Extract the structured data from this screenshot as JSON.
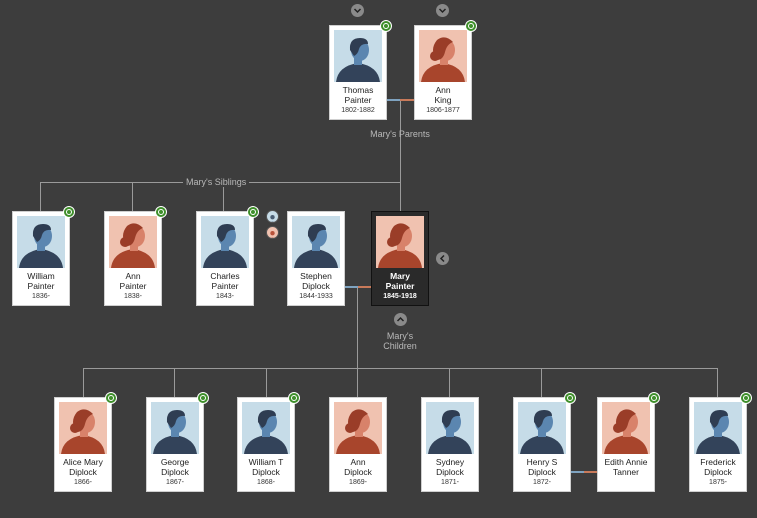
{
  "colors": {
    "background": "#3d3d3d",
    "male_bg": "#c6dce8",
    "female_bg": "#f0c2b0",
    "badge": "#3f8f2b"
  },
  "parents": {
    "label": "Mary's Parents",
    "father": {
      "name1": "Thomas",
      "name2": "Painter",
      "years": "1802-1882",
      "gender": "male",
      "icon": "hint-leaf-icon"
    },
    "mother": {
      "name1": "Ann",
      "name2": "King",
      "years": "1806-1877",
      "gender": "female",
      "icon": "hint-leaf-icon"
    }
  },
  "siblings": {
    "label": "Mary's Siblings",
    "people": [
      {
        "name1": "William",
        "name2": "Painter",
        "years": "1836-",
        "gender": "male"
      },
      {
        "name1": "Ann",
        "name2": "Painter",
        "years": "1838-",
        "gender": "female"
      },
      {
        "name1": "Charles",
        "name2": "Painter",
        "years": "1843-",
        "gender": "male"
      },
      {
        "name1": "Stephen",
        "name2": "Diplock",
        "years": "1844-1933",
        "gender": "male"
      }
    ]
  },
  "focus": {
    "name1": "Mary",
    "name2": "Painter",
    "years": "1845-1918",
    "gender": "female"
  },
  "children": {
    "label1": "Mary's",
    "label2": "Children",
    "people": [
      {
        "name1": "Alice Mary",
        "name2": "Diplock",
        "years": "1866-",
        "gender": "female"
      },
      {
        "name1": "George",
        "name2": "Diplock",
        "years": "1867-",
        "gender": "male"
      },
      {
        "name1": "William T",
        "name2": "Diplock",
        "years": "1868-",
        "gender": "male"
      },
      {
        "name1": "Ann",
        "name2": "Diplock",
        "years": "1869-",
        "gender": "female"
      },
      {
        "name1": "Sydney",
        "name2": "Diplock",
        "years": "1871-",
        "gender": "male"
      },
      {
        "name1": "Henry S",
        "name2": "Diplock",
        "years": "1872-",
        "gender": "male"
      },
      {
        "name1": "Edith Annie",
        "name2": "Tanner",
        "years": "",
        "gender": "female"
      },
      {
        "name1": "Frederick",
        "name2": "Diplock",
        "years": "1875-",
        "gender": "male"
      }
    ]
  },
  "icons": {
    "expand_up": "chevron-down-icon",
    "collapse_children": "chevron-up-icon",
    "collapse_side": "chevron-left-icon"
  }
}
